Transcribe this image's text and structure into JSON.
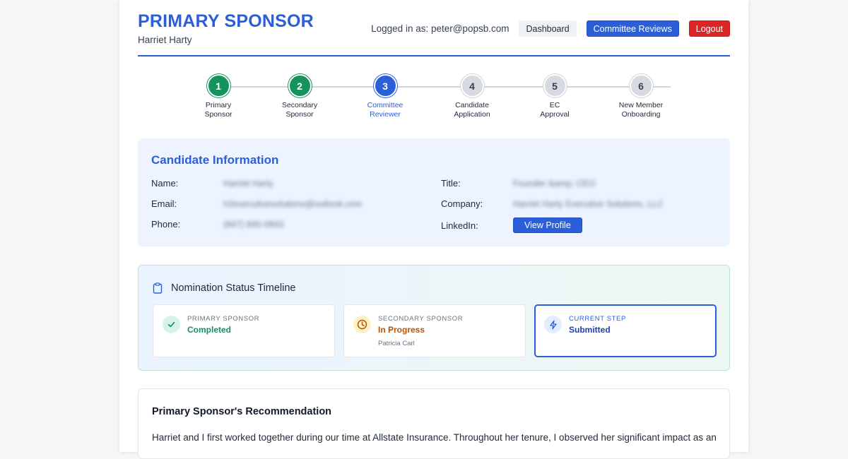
{
  "header": {
    "title": "PRIMARY SPONSOR",
    "subtitle": "Harriet Harty",
    "logged_in": "Logged in as: peter@popsb.com",
    "dashboard_label": "Dashboard",
    "committee_label": "Committee Reviews",
    "logout_label": "Logout"
  },
  "stepper": {
    "steps": [
      {
        "number": "1",
        "line1": "Primary",
        "line2": "Sponsor",
        "state": "done"
      },
      {
        "number": "2",
        "line1": "Secondary",
        "line2": "Sponsor",
        "state": "done"
      },
      {
        "number": "3",
        "line1": "Committee",
        "line2": "Reviewer",
        "state": "current"
      },
      {
        "number": "4",
        "line1": "Candidate",
        "line2": "Application",
        "state": "todo"
      },
      {
        "number": "5",
        "line1": "EC",
        "line2": "Approval",
        "state": "todo"
      },
      {
        "number": "6",
        "line1": "New Member",
        "line2": "Onboarding",
        "state": "todo"
      }
    ]
  },
  "candidate": {
    "title": "Candidate Information",
    "name_label": "Name:",
    "name_value": "Harriet Harty",
    "email_label": "Email:",
    "email_value": "h2executivesolutions@outlook.com",
    "phone_label": "Phone:",
    "phone_value": "(847) 845-0843",
    "title_label": "Title:",
    "title_value": "Founder &amp; CEO",
    "company_label": "Company:",
    "company_value": "Harriet Harty Executive Solutions, LLC",
    "linkedin_label": "LinkedIn:",
    "profile_button": "View Profile"
  },
  "timeline": {
    "title": "Nomination Status Timeline",
    "cards": [
      {
        "caption": "PRIMARY SPONSOR",
        "status": "Completed",
        "person": "",
        "icon": "check-icon"
      },
      {
        "caption": "SECONDARY SPONSOR",
        "status": "In Progress",
        "person": "Patricia Carl",
        "icon": "clock-icon"
      },
      {
        "caption": "CURRENT STEP",
        "status": "Submitted",
        "person": "",
        "icon": "bolt-icon"
      }
    ]
  },
  "recommendation": {
    "title": "Primary Sponsor's Recommendation",
    "body": "Harriet and I first worked together during our time at Allstate Insurance. Throughout her tenure, I observed her significant impact as an"
  },
  "colors": {
    "accent": "#2b5fd9",
    "success": "#14935f",
    "warning": "#b45309",
    "danger": "#dc2626"
  }
}
